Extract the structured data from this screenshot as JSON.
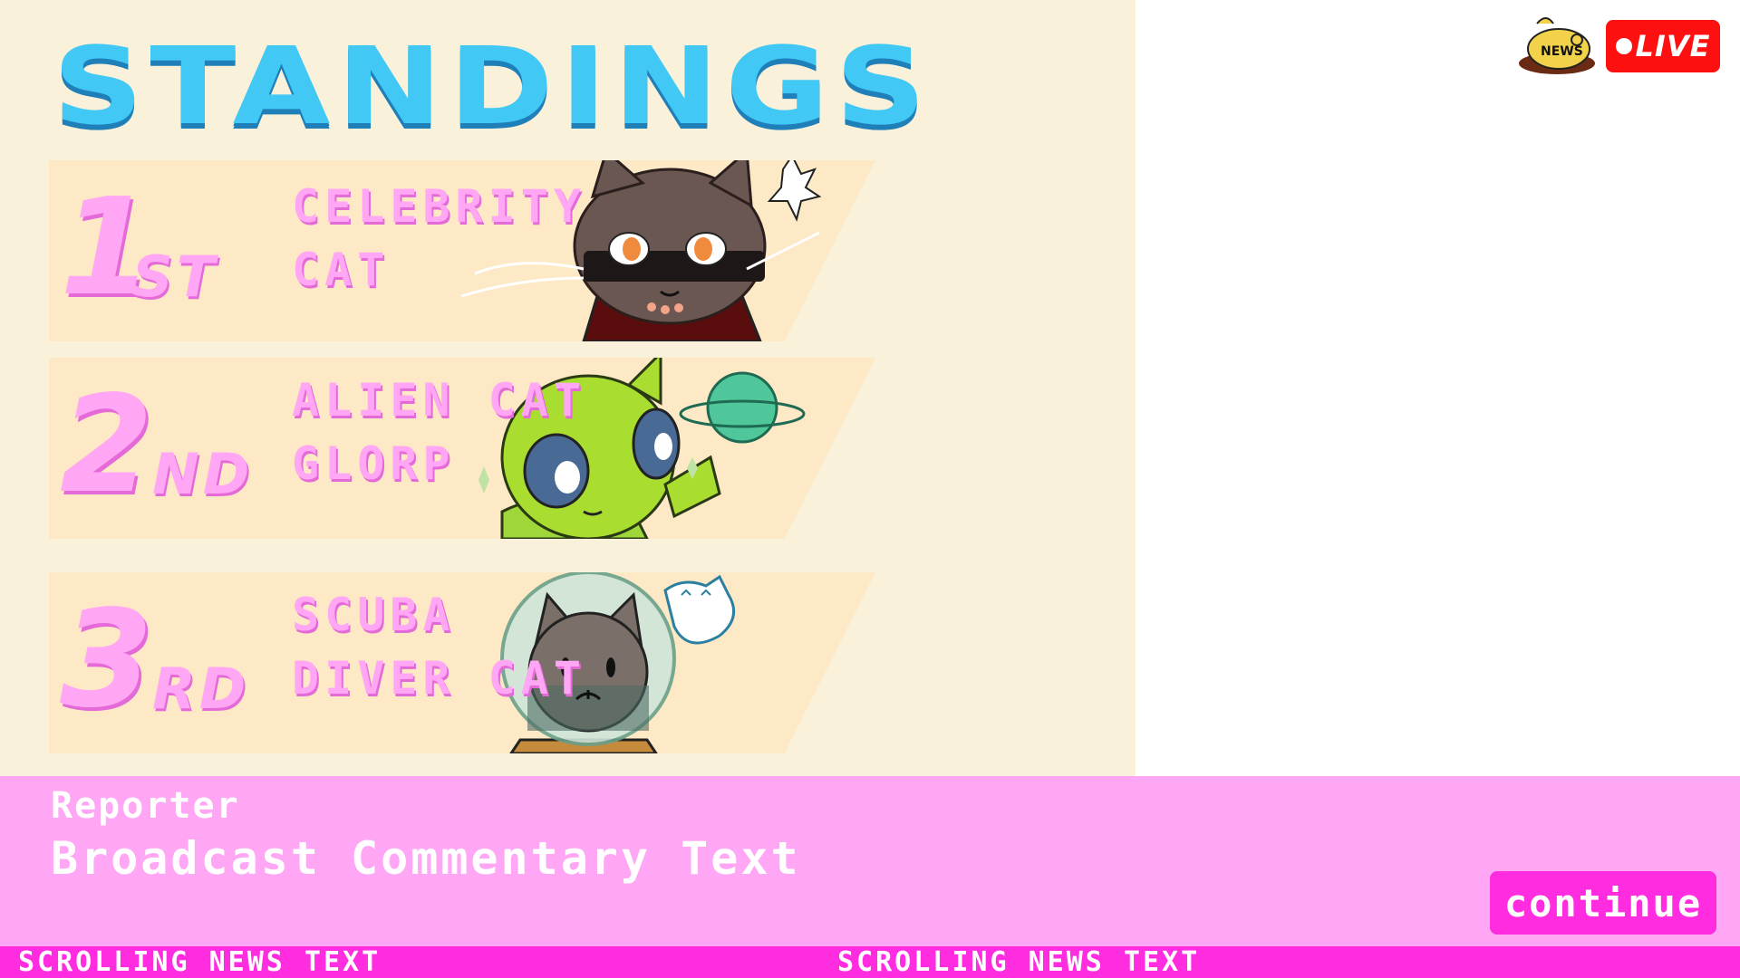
{
  "standings": {
    "title": "STANDINGS",
    "entries": [
      {
        "rank": "1",
        "suffix": "ST",
        "name_lines": [
          "CELEBRITY",
          "CAT"
        ],
        "portrait": "celebrity-cat-portrait"
      },
      {
        "rank": "2",
        "suffix": "ND",
        "name_lines": [
          "ALIEN CAT",
          "GLORP"
        ],
        "portrait": "alien-cat-portrait"
      },
      {
        "rank": "3",
        "suffix": "RD",
        "name_lines": [
          "SCUBA",
          "DIVER CAT"
        ],
        "portrait": "scuba-diver-cat-portrait"
      }
    ]
  },
  "badges": {
    "news_logo": "NEWS",
    "live_label": "LIVE"
  },
  "dialog": {
    "speaker": "Reporter",
    "text": "Broadcast Commentary Text",
    "continue_label": "continue"
  },
  "ticker": {
    "items": [
      "SCROLLING NEWS TEXT",
      "SCROLLING NEWS TEXT"
    ]
  },
  "colors": {
    "panel_bg": "#faf1da",
    "row_bg": "#fde9c6",
    "title_blue": "#42c8f5",
    "pink": "#ffa6f5",
    "hot_pink": "#ff2ce0",
    "live_red": "#ff1010"
  }
}
